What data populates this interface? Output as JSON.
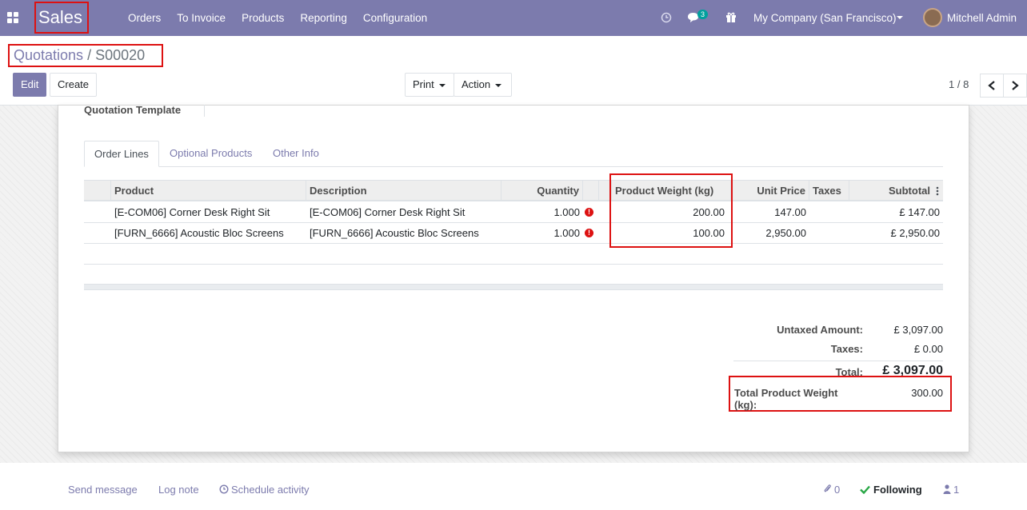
{
  "nav": {
    "brand": "Sales",
    "menu": [
      "Orders",
      "To Invoice",
      "Products",
      "Reporting",
      "Configuration"
    ],
    "messages_count": "3",
    "company": "My Company (San Francisco)",
    "user": "Mitchell Admin"
  },
  "control": {
    "breadcrumb_parent": "Quotations",
    "breadcrumb_sep": "/",
    "breadcrumb_current": "S00020",
    "edit_label": "Edit",
    "create_label": "Create",
    "print_label": "Print",
    "action_label": "Action",
    "pager": "1 / 8"
  },
  "form": {
    "quotation_template_label": "Quotation Template",
    "tabs": [
      "Order Lines",
      "Optional Products",
      "Other Info"
    ],
    "columns": {
      "product": "Product",
      "description": "Description",
      "quantity": "Quantity",
      "weight": "Product Weight (kg)",
      "unit_price": "Unit Price",
      "taxes": "Taxes",
      "subtotal": "Subtotal"
    },
    "lines": [
      {
        "product": "[E-COM06] Corner Desk Right Sit",
        "description": "[E-COM06] Corner Desk Right Sit",
        "quantity": "1.000",
        "weight": "200.00",
        "unit_price": "147.00",
        "taxes": "",
        "subtotal": "£ 147.00"
      },
      {
        "product": "[FURN_6666] Acoustic Bloc Screens",
        "description": "[FURN_6666] Acoustic Bloc Screens",
        "quantity": "1.000",
        "weight": "100.00",
        "unit_price": "2,950.00",
        "taxes": "",
        "subtotal": "£ 2,950.00"
      }
    ],
    "totals": {
      "untaxed_label": "Untaxed Amount:",
      "untaxed_value": "£ 3,097.00",
      "taxes_label": "Taxes:",
      "taxes_value": "£ 0.00",
      "total_label": "Total:",
      "total_value": "£ 3,097.00",
      "weight_label": "Total Product Weight (kg):",
      "weight_value": "300.00"
    }
  },
  "chatter": {
    "send_message": "Send message",
    "log_note": "Log note",
    "schedule_activity": "Schedule activity",
    "attachments": "0",
    "following": "Following",
    "followers": "1"
  },
  "colors": {
    "brand": "#7c7bad",
    "highlight_box": "#dd1111",
    "badge": "#00a09d"
  }
}
